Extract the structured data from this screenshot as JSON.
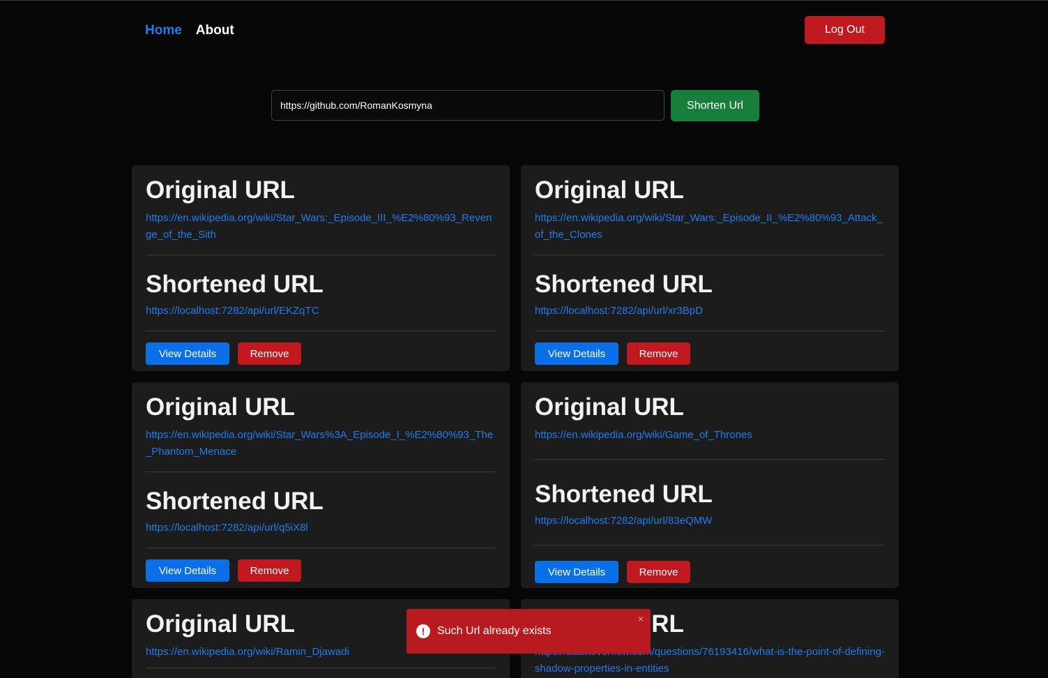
{
  "nav": {
    "home": "Home",
    "about": "About",
    "logout": "Log Out"
  },
  "form": {
    "url_value": "https://github.com/RomanKosmyna",
    "shorten_label": "Shorten Url"
  },
  "labels": {
    "original": "Original URL",
    "shortened": "Shortened URL",
    "view_details": "View Details",
    "remove": "Remove"
  },
  "cards": [
    {
      "original": "https://en.wikipedia.org/wiki/Star_Wars:_Episode_III_%E2%80%93_Revenge_of_the_Sith",
      "shortened": "https://localhost:7282/api/url/EKZqTC"
    },
    {
      "original": "https://en.wikipedia.org/wiki/Star_Wars:_Episode_II_%E2%80%93_Attack_of_the_Clones",
      "shortened": "https://localhost:7282/api/url/xr3BpD"
    },
    {
      "original": "https://en.wikipedia.org/wiki/Star_Wars%3A_Episode_I_%E2%80%93_The_Phantom_Menace",
      "shortened": "https://localhost:7282/api/url/q5iX8l"
    },
    {
      "original": "https://en.wikipedia.org/wiki/Game_of_Thrones",
      "shortened": "https://localhost:7282/api/url/83eQMW"
    },
    {
      "original": "https://en.wikipedia.org/wiki/Ramin_Djawadi"
    },
    {
      "original": "https://stackoverflow.com/questions/76193416/what-is-the-point-of-defining-shadow-properties-in-entities"
    }
  ],
  "toast": {
    "message": "Such Url already exists",
    "icon": "exclamation-icon",
    "close": "×"
  },
  "colors": {
    "link": "#1f7cf0",
    "danger": "#c0191f",
    "success": "#177f3b",
    "primary": "#0b6fe8"
  }
}
